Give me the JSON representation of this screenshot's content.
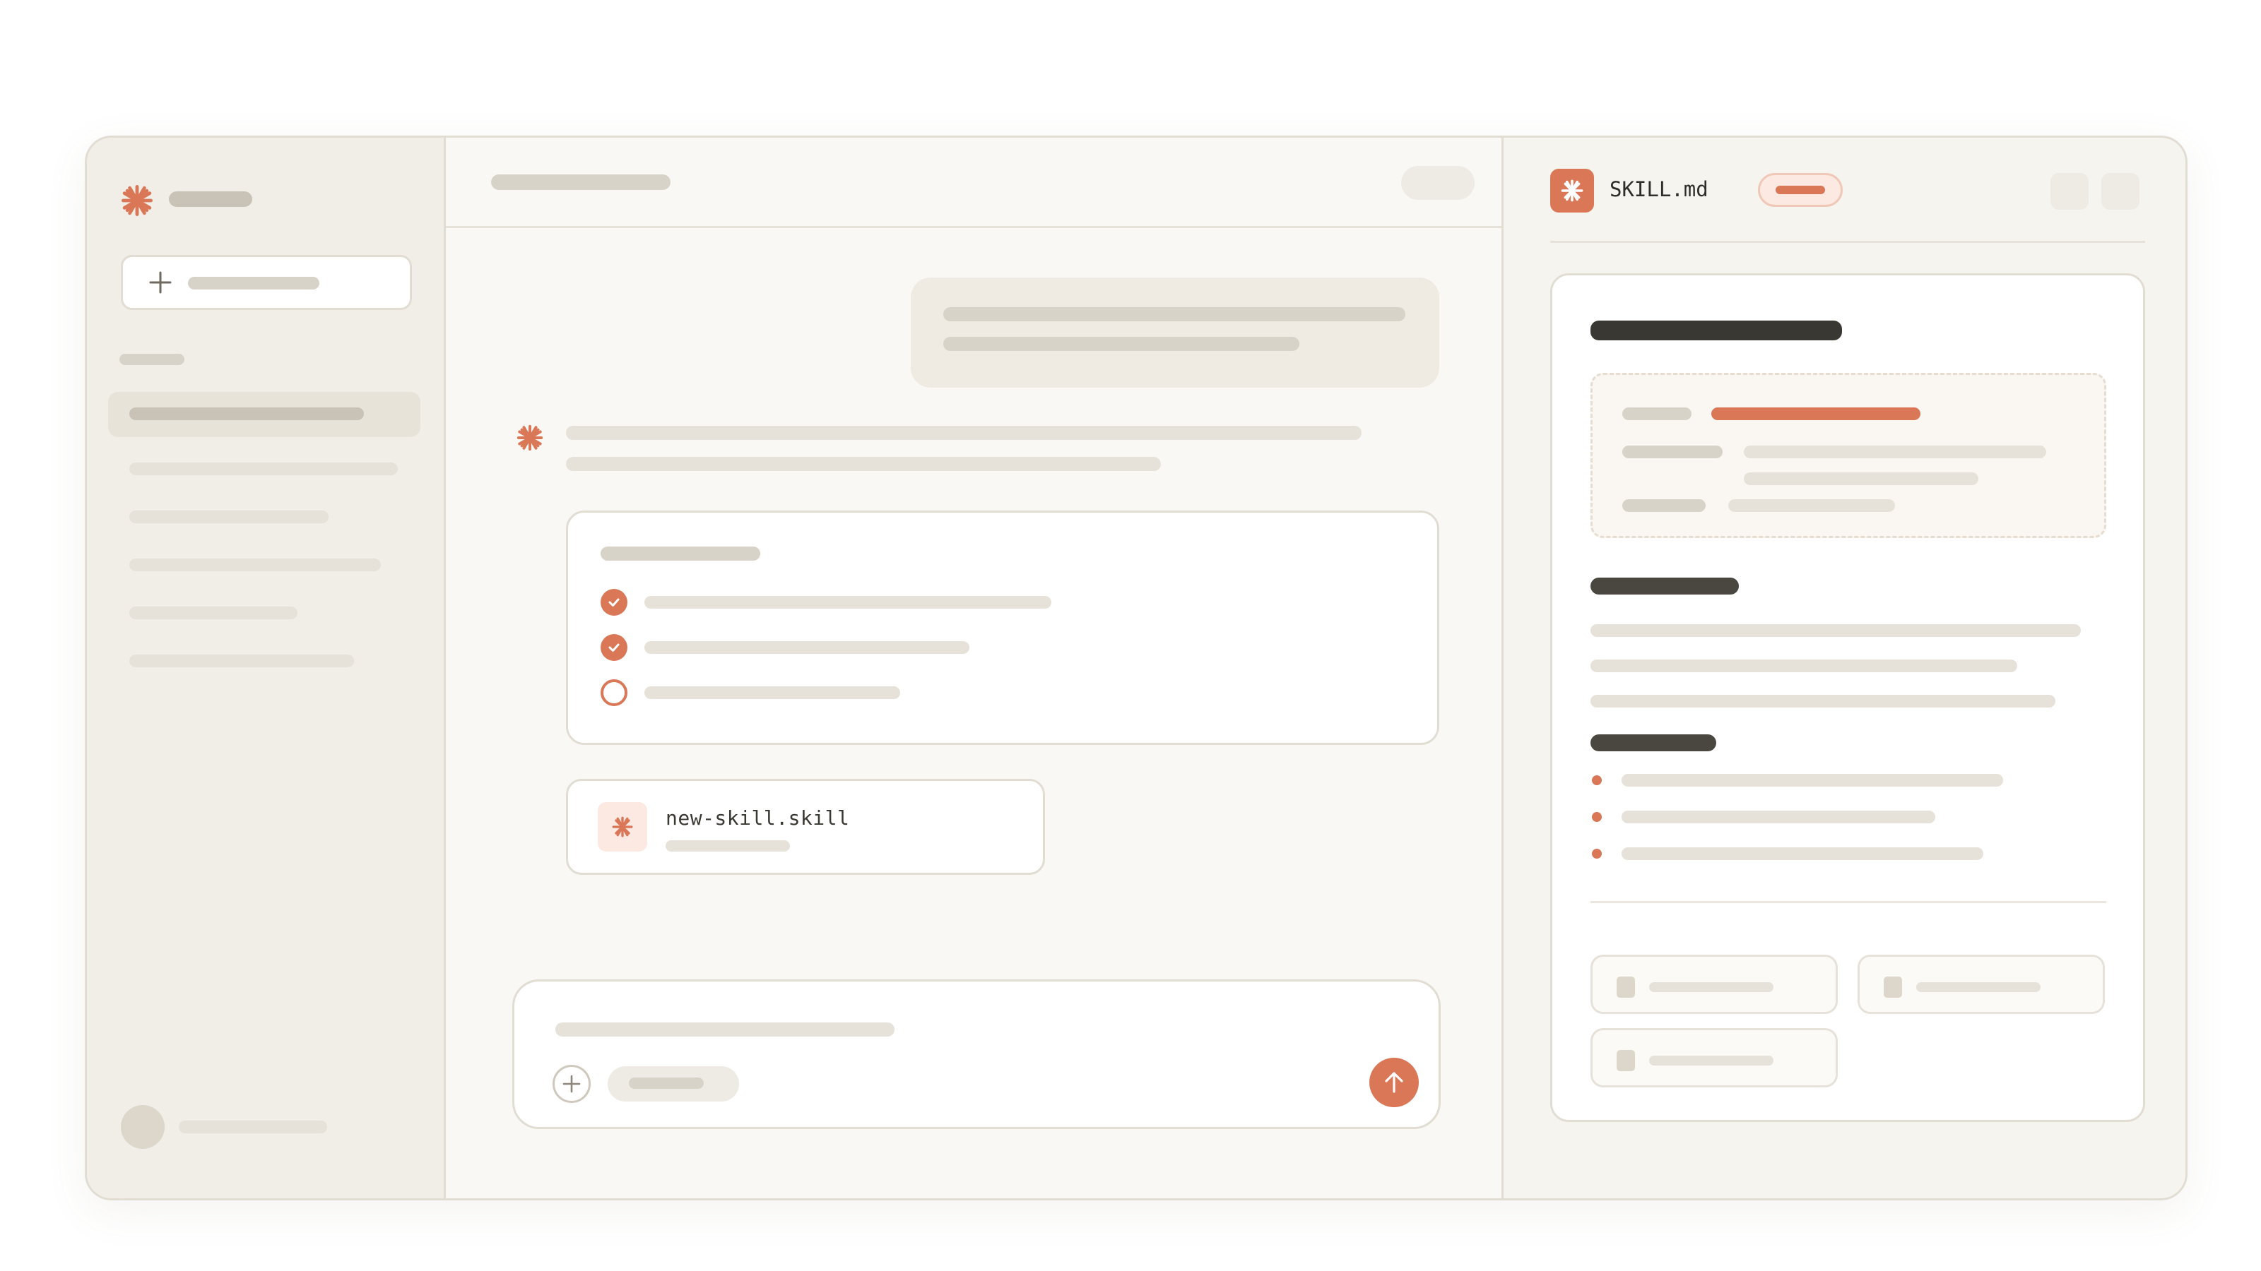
{
  "chat": {
    "attachment": {
      "file_name": "new-skill.skill",
      "icon": "asterisk-icon"
    },
    "tasks": [
      {
        "status": "done"
      },
      {
        "status": "done"
      },
      {
        "status": "pending"
      }
    ]
  },
  "panel": {
    "file_title": "SKILL.md",
    "file_icon": "asterisk-icon"
  },
  "colors": {
    "accent": "#d97757",
    "background": "#f9f8f5",
    "sidebar": "#f1eee8",
    "border": "#e2ddd3"
  },
  "icons": [
    "asterisk-logo-icon",
    "plus-icon",
    "check-circle-icon",
    "empty-circle-icon",
    "arrow-up-icon"
  ]
}
